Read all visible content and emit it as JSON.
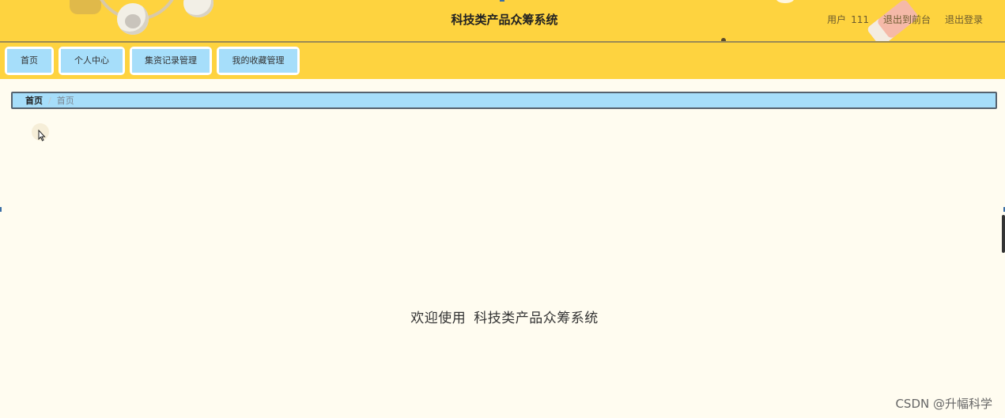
{
  "header": {
    "title": "科技类产品众筹系统",
    "user_label": "用户",
    "user_name": "111",
    "back_to_front": "退出到前台",
    "logout": "退出登录"
  },
  "nav": {
    "items": [
      {
        "label": "首页"
      },
      {
        "label": "个人中心"
      },
      {
        "label": "集资记录管理"
      },
      {
        "label": "我的收藏管理"
      }
    ]
  },
  "breadcrumb": {
    "home": "首页",
    "separator": "/",
    "current": "首页"
  },
  "main": {
    "welcome_prefix": "欢迎使用",
    "system_name": "科技类产品众筹系统"
  },
  "watermark": "CSDN @升幅科学",
  "colors": {
    "header_bg": "#fed33f",
    "nav_button_bg": "#a6defa",
    "page_bg": "#fffcf0"
  }
}
